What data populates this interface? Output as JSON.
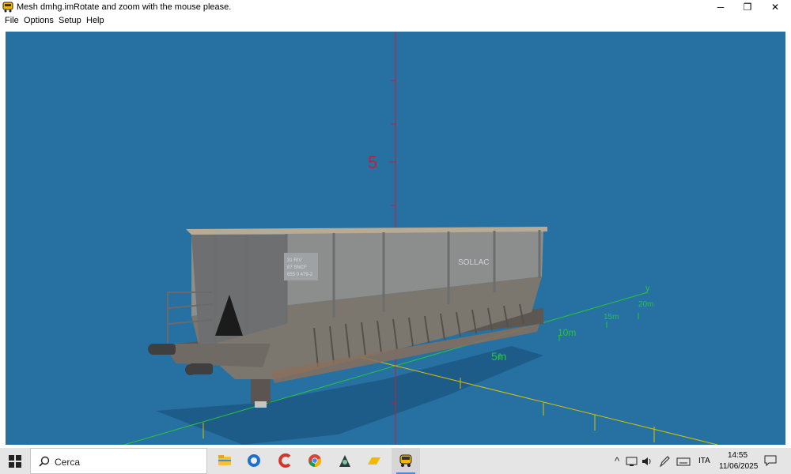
{
  "window": {
    "title": "Mesh dmhg.im",
    "message": "Rotate and zoom with the mouse please.",
    "controls": {
      "minimize": "─",
      "maximize": "❐",
      "close": "✕"
    }
  },
  "menu": {
    "items": [
      "File",
      "Options",
      "Setup",
      "Help"
    ]
  },
  "viewport": {
    "background": "#2671a2",
    "axis_labels": {
      "vertical_5": "5",
      "y_axis": "y"
    },
    "ground_axis_labels": [
      "5m",
      "10m",
      "15m",
      "20m"
    ],
    "wagon_markings": {
      "brand": "SOLLAC",
      "plate_lines": [
        "31 RIV",
        "87 SNCF",
        "655 0 479-2"
      ]
    }
  },
  "taskbar": {
    "search_placeholder": "Cerca",
    "apps": [
      "file-explorer",
      "browser-blue",
      "ccleaner",
      "chrome",
      "game-app",
      "folder-yellow",
      "train-app"
    ],
    "tray": {
      "language": "ITA",
      "time": "14:55",
      "date": "11/06/2025"
    }
  }
}
